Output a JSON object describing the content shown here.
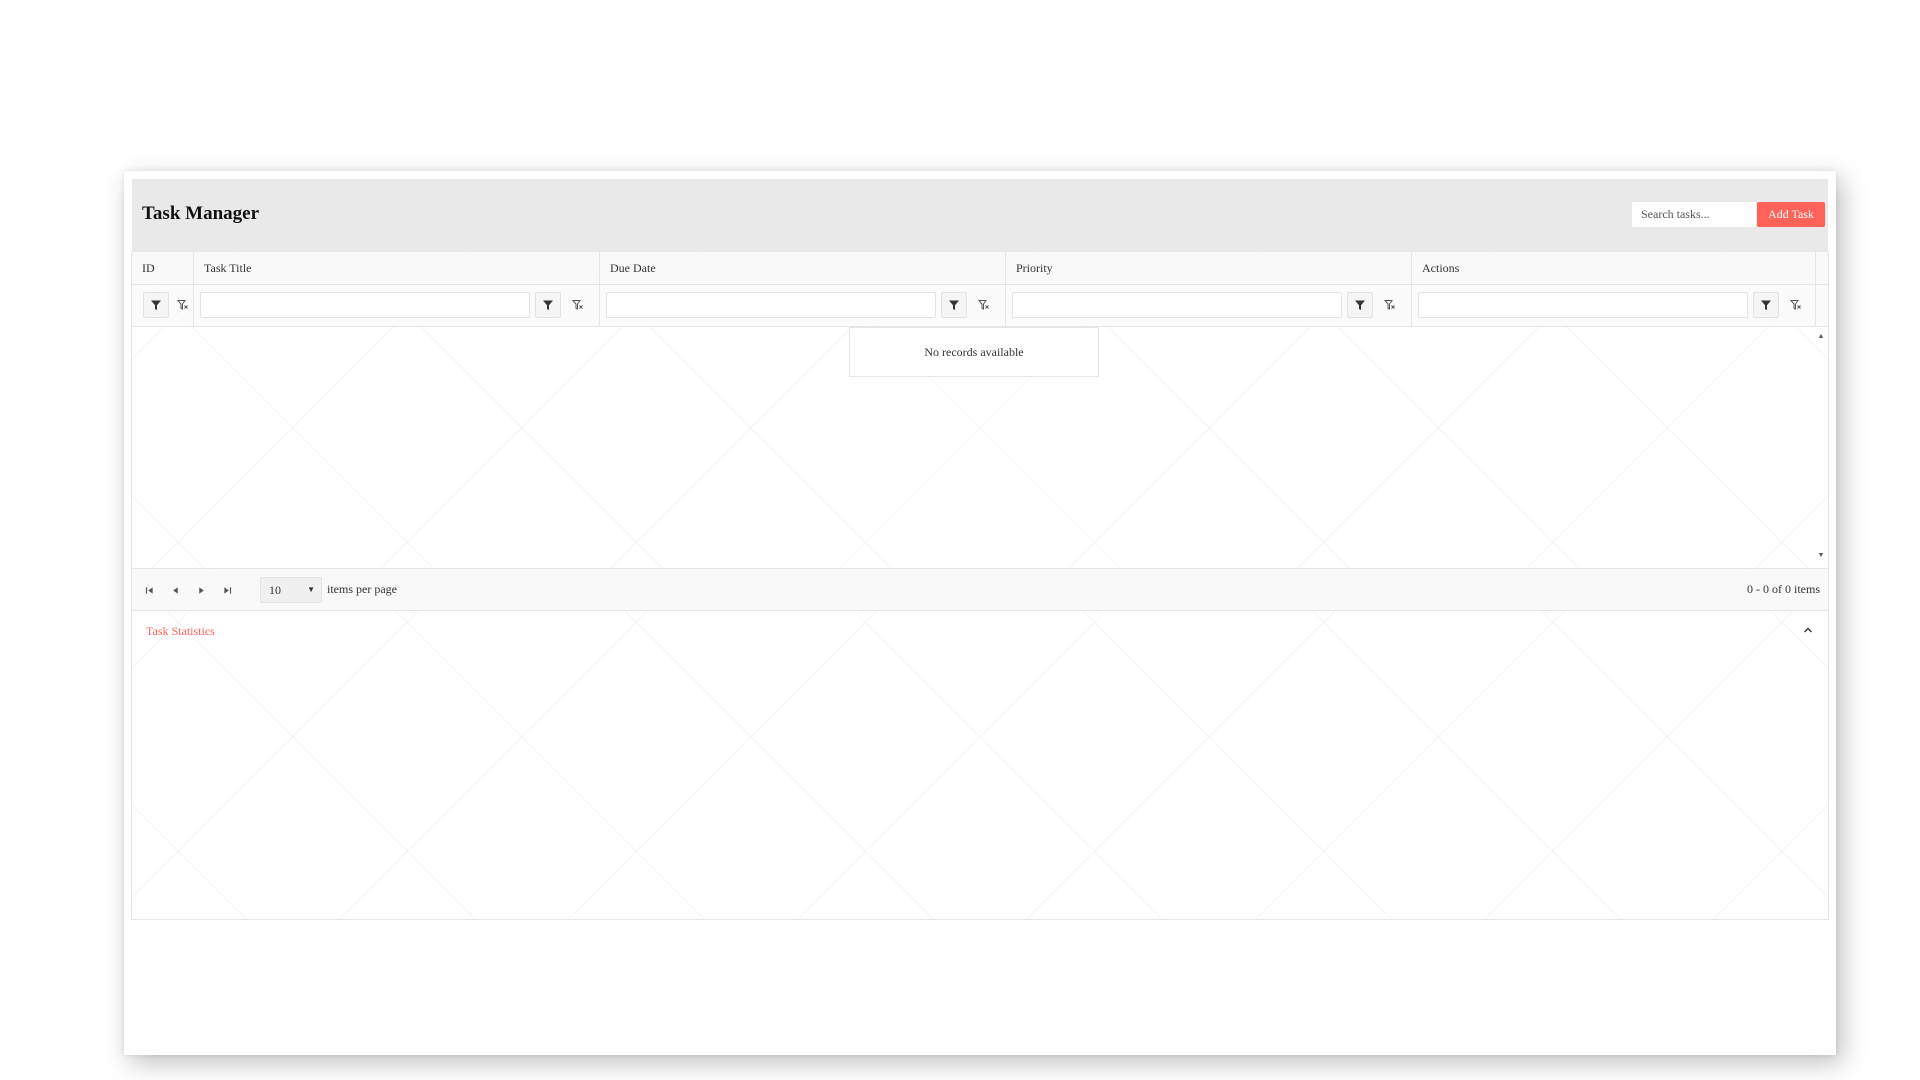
{
  "header": {
    "title": "Task Manager",
    "search_placeholder": "Search tasks...",
    "add_button_label": "Add Task",
    "accent_color": "#ff6358"
  },
  "grid": {
    "columns": [
      {
        "label": "ID"
      },
      {
        "label": "Task Title"
      },
      {
        "label": "Due Date"
      },
      {
        "label": "Priority"
      },
      {
        "label": "Actions"
      }
    ],
    "filter_icons": [
      "filter-icon",
      "clear-filter-icon"
    ],
    "empty_message": "No records available"
  },
  "pager": {
    "page_size": "10",
    "items_per_page_label": "items per page",
    "info": "0 - 0 of 0 items",
    "nav_icons": [
      "first-page-icon",
      "previous-page-icon",
      "next-page-icon",
      "last-page-icon"
    ]
  },
  "stats_panel": {
    "title": "Task Statistics",
    "expanded": true,
    "toggle_icon": "chevron-up-icon"
  }
}
